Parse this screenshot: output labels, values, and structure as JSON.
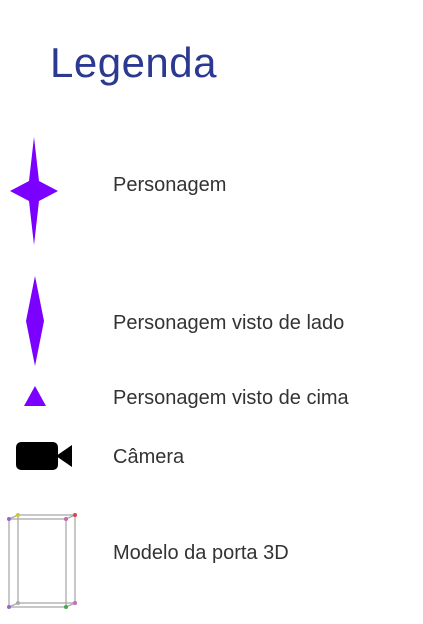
{
  "legend": {
    "title": "Legenda",
    "items": [
      {
        "label": "Personagem",
        "icon": "four-point-star-icon",
        "color": "#7b00ff"
      },
      {
        "label": "Personagem visto de lado",
        "icon": "vertical-diamond-icon",
        "color": "#7b00ff"
      },
      {
        "label": "Personagem visto de cima",
        "icon": "triangle-icon",
        "color": "#7b00ff"
      },
      {
        "label": "Câmera",
        "icon": "video-camera-icon",
        "color": "#000000"
      },
      {
        "label": "Modelo da porta 3D",
        "icon": "wireframe-door-icon",
        "color": "#888888"
      }
    ]
  }
}
